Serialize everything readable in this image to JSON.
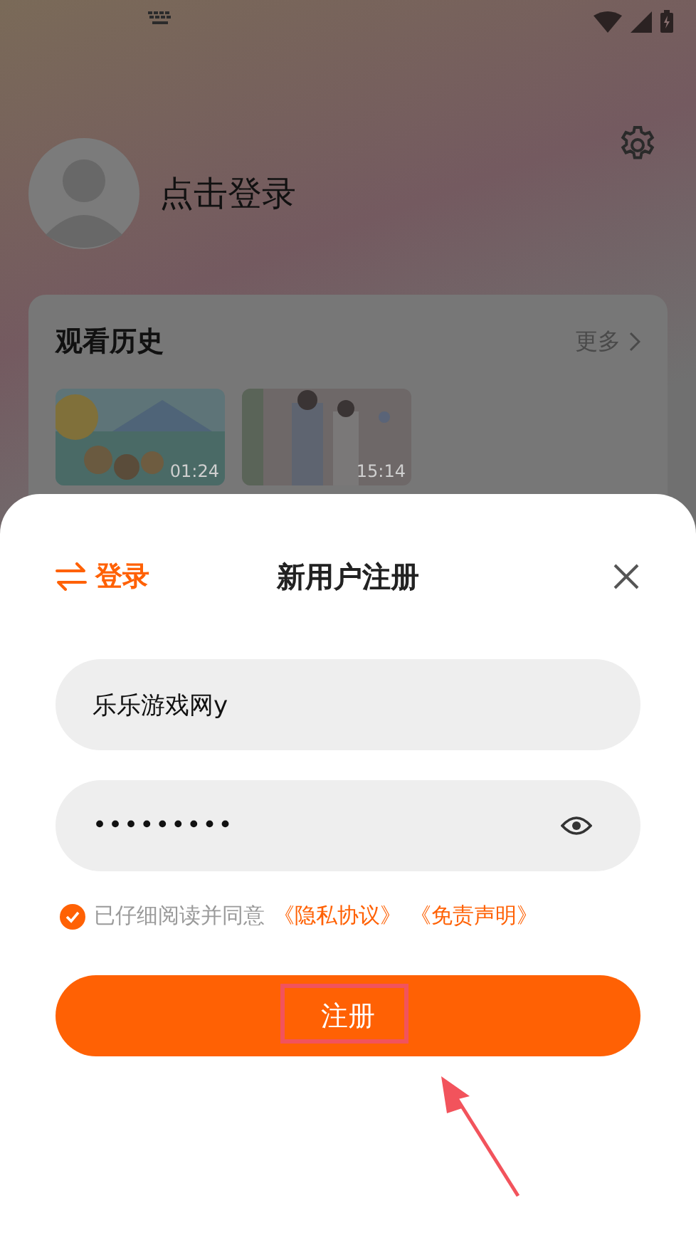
{
  "profile": {
    "login_prompt": "点击登录"
  },
  "history": {
    "title": "观看历史",
    "more": "更多",
    "items": [
      {
        "kind": "picture",
        "duration": "01:24"
      },
      {
        "kind": "picture",
        "duration": "15:14"
      }
    ]
  },
  "sheet": {
    "switch_label": "登录",
    "title": "新用户注册",
    "fields": [
      {
        "kind": "text",
        "value": "乐乐游戏网y"
      },
      {
        "kind": "password",
        "value": "•••••••••"
      }
    ],
    "agreement": {
      "checked": true,
      "text": "已仔细阅读并同意",
      "links": [
        "《隐私协议》",
        "《免责声明》"
      ]
    },
    "submit": "注册"
  }
}
